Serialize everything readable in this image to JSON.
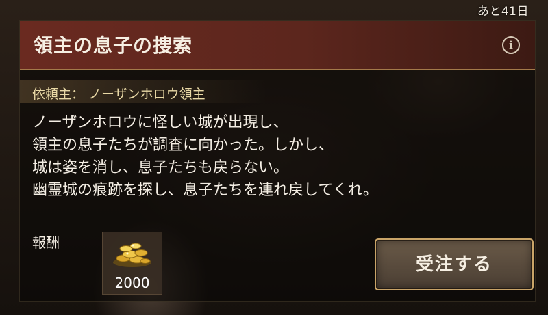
{
  "days_left": "あと41日",
  "quest": {
    "title": "領主の息子の捜索",
    "client": "依頼主： ノーザンホロウ領主",
    "description": [
      "ノーザンホロウに怪しい城が出現し、",
      "領主の息子たちが調査に向かった。しかし、",
      "城は姿を消し、息子たちも戻らない。",
      "幽霊城の痕跡を探し、息子たちを連れ戻してくれ。"
    ]
  },
  "reward": {
    "label": "報酬",
    "amount": "2000",
    "icon": "gold-coins-icon"
  },
  "accept_button": "受注する",
  "info_icon": "i",
  "colors": {
    "title_bar": "#6a2a20",
    "client_text": "#e9d9a6",
    "button_border": "#c9a468"
  }
}
